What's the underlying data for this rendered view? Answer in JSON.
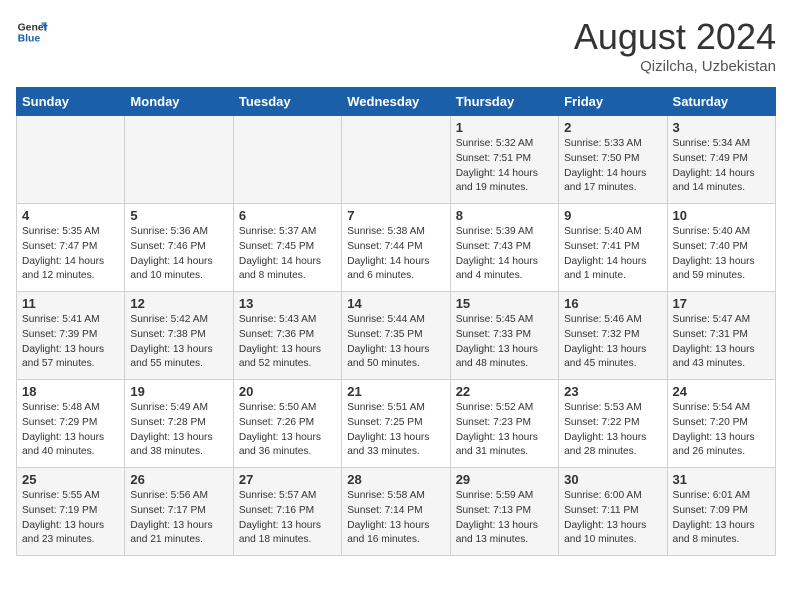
{
  "header": {
    "logo_general": "General",
    "logo_blue": "Blue",
    "month_year": "August 2024",
    "location": "Qizilcha, Uzbekistan"
  },
  "weekdays": [
    "Sunday",
    "Monday",
    "Tuesday",
    "Wednesday",
    "Thursday",
    "Friday",
    "Saturday"
  ],
  "weeks": [
    [
      {
        "day": "",
        "text": ""
      },
      {
        "day": "",
        "text": ""
      },
      {
        "day": "",
        "text": ""
      },
      {
        "day": "",
        "text": ""
      },
      {
        "day": "1",
        "text": "Sunrise: 5:32 AM\nSunset: 7:51 PM\nDaylight: 14 hours\nand 19 minutes."
      },
      {
        "day": "2",
        "text": "Sunrise: 5:33 AM\nSunset: 7:50 PM\nDaylight: 14 hours\nand 17 minutes."
      },
      {
        "day": "3",
        "text": "Sunrise: 5:34 AM\nSunset: 7:49 PM\nDaylight: 14 hours\nand 14 minutes."
      }
    ],
    [
      {
        "day": "4",
        "text": "Sunrise: 5:35 AM\nSunset: 7:47 PM\nDaylight: 14 hours\nand 12 minutes."
      },
      {
        "day": "5",
        "text": "Sunrise: 5:36 AM\nSunset: 7:46 PM\nDaylight: 14 hours\nand 10 minutes."
      },
      {
        "day": "6",
        "text": "Sunrise: 5:37 AM\nSunset: 7:45 PM\nDaylight: 14 hours\nand 8 minutes."
      },
      {
        "day": "7",
        "text": "Sunrise: 5:38 AM\nSunset: 7:44 PM\nDaylight: 14 hours\nand 6 minutes."
      },
      {
        "day": "8",
        "text": "Sunrise: 5:39 AM\nSunset: 7:43 PM\nDaylight: 14 hours\nand 4 minutes."
      },
      {
        "day": "9",
        "text": "Sunrise: 5:40 AM\nSunset: 7:41 PM\nDaylight: 14 hours\nand 1 minute."
      },
      {
        "day": "10",
        "text": "Sunrise: 5:40 AM\nSunset: 7:40 PM\nDaylight: 13 hours\nand 59 minutes."
      }
    ],
    [
      {
        "day": "11",
        "text": "Sunrise: 5:41 AM\nSunset: 7:39 PM\nDaylight: 13 hours\nand 57 minutes."
      },
      {
        "day": "12",
        "text": "Sunrise: 5:42 AM\nSunset: 7:38 PM\nDaylight: 13 hours\nand 55 minutes."
      },
      {
        "day": "13",
        "text": "Sunrise: 5:43 AM\nSunset: 7:36 PM\nDaylight: 13 hours\nand 52 minutes."
      },
      {
        "day": "14",
        "text": "Sunrise: 5:44 AM\nSunset: 7:35 PM\nDaylight: 13 hours\nand 50 minutes."
      },
      {
        "day": "15",
        "text": "Sunrise: 5:45 AM\nSunset: 7:33 PM\nDaylight: 13 hours\nand 48 minutes."
      },
      {
        "day": "16",
        "text": "Sunrise: 5:46 AM\nSunset: 7:32 PM\nDaylight: 13 hours\nand 45 minutes."
      },
      {
        "day": "17",
        "text": "Sunrise: 5:47 AM\nSunset: 7:31 PM\nDaylight: 13 hours\nand 43 minutes."
      }
    ],
    [
      {
        "day": "18",
        "text": "Sunrise: 5:48 AM\nSunset: 7:29 PM\nDaylight: 13 hours\nand 40 minutes."
      },
      {
        "day": "19",
        "text": "Sunrise: 5:49 AM\nSunset: 7:28 PM\nDaylight: 13 hours\nand 38 minutes."
      },
      {
        "day": "20",
        "text": "Sunrise: 5:50 AM\nSunset: 7:26 PM\nDaylight: 13 hours\nand 36 minutes."
      },
      {
        "day": "21",
        "text": "Sunrise: 5:51 AM\nSunset: 7:25 PM\nDaylight: 13 hours\nand 33 minutes."
      },
      {
        "day": "22",
        "text": "Sunrise: 5:52 AM\nSunset: 7:23 PM\nDaylight: 13 hours\nand 31 minutes."
      },
      {
        "day": "23",
        "text": "Sunrise: 5:53 AM\nSunset: 7:22 PM\nDaylight: 13 hours\nand 28 minutes."
      },
      {
        "day": "24",
        "text": "Sunrise: 5:54 AM\nSunset: 7:20 PM\nDaylight: 13 hours\nand 26 minutes."
      }
    ],
    [
      {
        "day": "25",
        "text": "Sunrise: 5:55 AM\nSunset: 7:19 PM\nDaylight: 13 hours\nand 23 minutes."
      },
      {
        "day": "26",
        "text": "Sunrise: 5:56 AM\nSunset: 7:17 PM\nDaylight: 13 hours\nand 21 minutes."
      },
      {
        "day": "27",
        "text": "Sunrise: 5:57 AM\nSunset: 7:16 PM\nDaylight: 13 hours\nand 18 minutes."
      },
      {
        "day": "28",
        "text": "Sunrise: 5:58 AM\nSunset: 7:14 PM\nDaylight: 13 hours\nand 16 minutes."
      },
      {
        "day": "29",
        "text": "Sunrise: 5:59 AM\nSunset: 7:13 PM\nDaylight: 13 hours\nand 13 minutes."
      },
      {
        "day": "30",
        "text": "Sunrise: 6:00 AM\nSunset: 7:11 PM\nDaylight: 13 hours\nand 10 minutes."
      },
      {
        "day": "31",
        "text": "Sunrise: 6:01 AM\nSunset: 7:09 PM\nDaylight: 13 hours\nand 8 minutes."
      }
    ]
  ]
}
